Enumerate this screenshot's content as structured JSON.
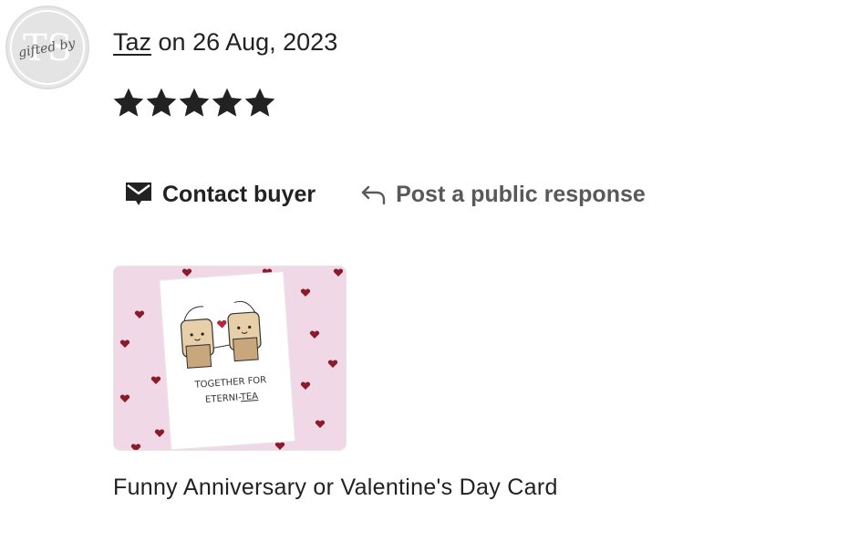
{
  "review": {
    "avatar": {
      "monogram": "TS",
      "script_text": "gifted by"
    },
    "reviewer_name": "Taz",
    "date_text": " on 26 Aug, 2023",
    "rating": 5,
    "rating_max": 5,
    "actions": {
      "contact_label": "Contact buyer",
      "contact_icon": "envelope-chat-icon",
      "respond_label": "Post a public response",
      "respond_icon": "reply-arrow-icon"
    },
    "product": {
      "card_line1": "TOGETHER FOR",
      "card_line2_prefix": "ETERNI-",
      "card_line2_underlined": "TEA",
      "title": "Funny Anniversary or Valentine's Day Card"
    }
  },
  "colors": {
    "text_primary": "#222222",
    "text_secondary": "#595959",
    "star": "#222222",
    "image_background": "#f1d8e7",
    "hearts": "#8b1a2b"
  }
}
